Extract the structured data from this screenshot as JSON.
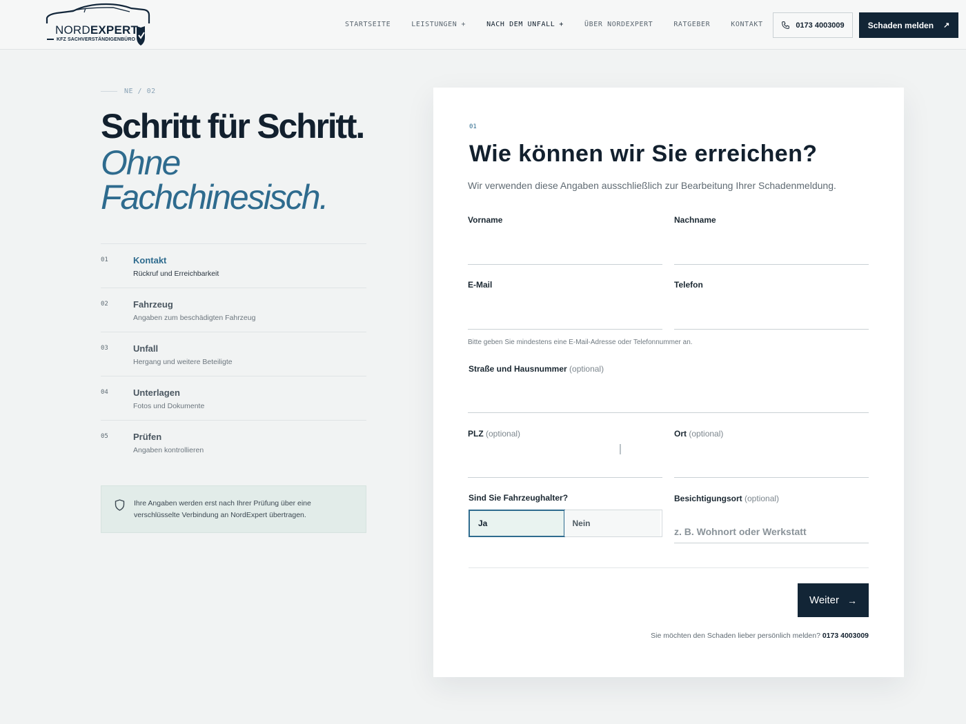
{
  "brand": {
    "name_light": "NORD",
    "name_bold": "EXPERT",
    "tagline": "KFZ SACHVERSTÄNDIGENBÜRO"
  },
  "nav": {
    "items": [
      {
        "label": "STARTSEITE",
        "plus": ""
      },
      {
        "label": "LEISTUNGEN",
        "plus": "+"
      },
      {
        "label": "NACH DEM UNFALL",
        "plus": "+"
      },
      {
        "label": "ÜBER NORDEXPERT",
        "plus": ""
      },
      {
        "label": "RATGEBER",
        "plus": ""
      },
      {
        "label": "KONTAKT",
        "plus": ""
      }
    ],
    "phone": "0173 4003009",
    "cta": "Schaden melden",
    "cta_icon": "arrow-up-right-icon"
  },
  "hero": {
    "eyebrow": "NE / 02",
    "title": "Schritt für Schritt.",
    "accent_line1": "Ohne",
    "accent_line2": "Fachchinesisch."
  },
  "steps": [
    {
      "num": "01",
      "title": "Kontakt",
      "desc": "Rückruf und Erreichbarkeit",
      "active": true
    },
    {
      "num": "02",
      "title": "Fahrzeug",
      "desc": "Angaben zum beschädigten Fahrzeug",
      "active": false
    },
    {
      "num": "03",
      "title": "Unfall",
      "desc": "Hergang und weitere Beteiligte",
      "active": false
    },
    {
      "num": "04",
      "title": "Unterlagen",
      "desc": "Fotos und Dokumente",
      "active": false
    },
    {
      "num": "05",
      "title": "Prüfen",
      "desc": "Angaben kontrollieren",
      "active": false
    }
  ],
  "security": {
    "text": "Ihre Angaben werden erst nach Ihrer Prüfung über eine verschlüsselte Verbindung an NordExpert übertragen."
  },
  "form": {
    "step": "01",
    "title": "Wie können wir Sie erreichen?",
    "subtitle": "Wir verwenden diese Angaben ausschließlich zur Bearbeitung Ihrer Schadenmeldung.",
    "optional_label": "(optional)",
    "fields": {
      "vorname": {
        "label": "Vorname",
        "value": ""
      },
      "nachname": {
        "label": "Nachname",
        "value": ""
      },
      "email": {
        "label": "E-Mail",
        "value": ""
      },
      "telefon": {
        "label": "Telefon",
        "value": ""
      },
      "strasse": {
        "label": "Straße und Hausnummer",
        "value": ""
      },
      "plz": {
        "label": "PLZ",
        "value": ""
      },
      "ort": {
        "label": "Ort",
        "value": ""
      },
      "besichtigungsort": {
        "label": "Besichtigungsort",
        "placeholder": "z. B. Wohnort oder Werkstatt"
      }
    },
    "hint": "Bitte geben Sie mindestens eine E-Mail-Adresse oder Telefonnummer an.",
    "halter": {
      "label": "Sind Sie Fahrzeughalter?",
      "options": [
        "Ja",
        "Nein"
      ],
      "selected": "Ja"
    },
    "next": "Weiter",
    "call_note": "Sie möchten den Schaden lieber persönlich melden?",
    "call_phone": "0173 4003009"
  },
  "colors": {
    "navy": "#122536",
    "accent": "#2e6b8e",
    "background": "#f1f3f3"
  }
}
